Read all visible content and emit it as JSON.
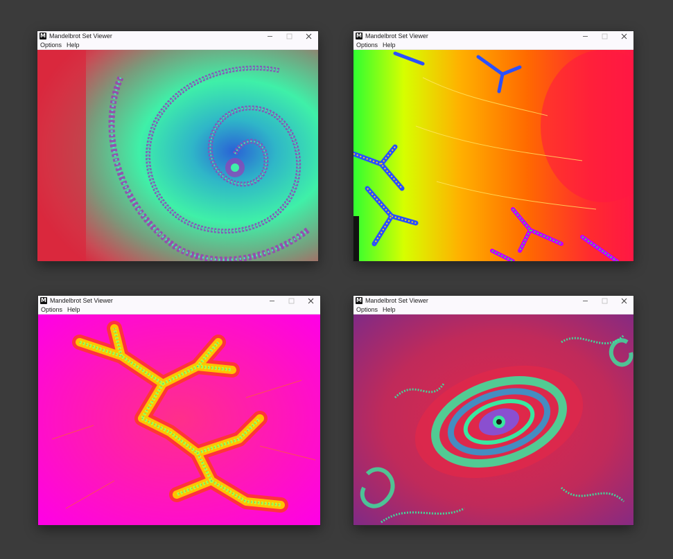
{
  "desktop": {
    "background": "#3b3b3b"
  },
  "windows": [
    {
      "title": "Mandelbrot Set Viewer",
      "app_icon": "M",
      "menu": [
        "Options",
        "Help"
      ],
      "controls": [
        "minimize-icon",
        "maximize-icon",
        "close-icon"
      ],
      "fractal": "spiral-seahorse",
      "palette": [
        "#d9283e",
        "#7a9a7b",
        "#3ff0a8",
        "#2a86d6",
        "#9a3fb4"
      ]
    },
    {
      "title": "Mandelbrot Set Viewer",
      "app_icon": "M",
      "menu": [
        "Options",
        "Help"
      ],
      "controls": [
        "minimize-icon",
        "maximize-icon",
        "close-icon"
      ],
      "fractal": "rainbow-dendrite",
      "palette": [
        "#ff1744",
        "#ff6a00",
        "#ffb000",
        "#d6ff00",
        "#30ff30",
        "#2a50ff",
        "#c000ff"
      ]
    },
    {
      "title": "Mandelbrot Set Viewer",
      "app_icon": "M",
      "menu": [
        "Options",
        "Help"
      ],
      "controls": [
        "minimize-icon",
        "maximize-icon",
        "close-icon"
      ],
      "fractal": "magenta-dendrite",
      "palette": [
        "#ff00e6",
        "#ff2f6a",
        "#ff3b1a",
        "#ffc400",
        "#b8ff3a",
        "#1fd0c0"
      ]
    },
    {
      "title": "Mandelbrot Set Viewer",
      "app_icon": "M",
      "menu": [
        "Options",
        "Help"
      ],
      "controls": [
        "minimize-icon",
        "maximize-icon",
        "close-icon"
      ],
      "fractal": "purple-spiral-island",
      "palette": [
        "#7a2a8a",
        "#e0284a",
        "#3ae8a0",
        "#2a6fd6",
        "#1a1a1a"
      ]
    }
  ]
}
